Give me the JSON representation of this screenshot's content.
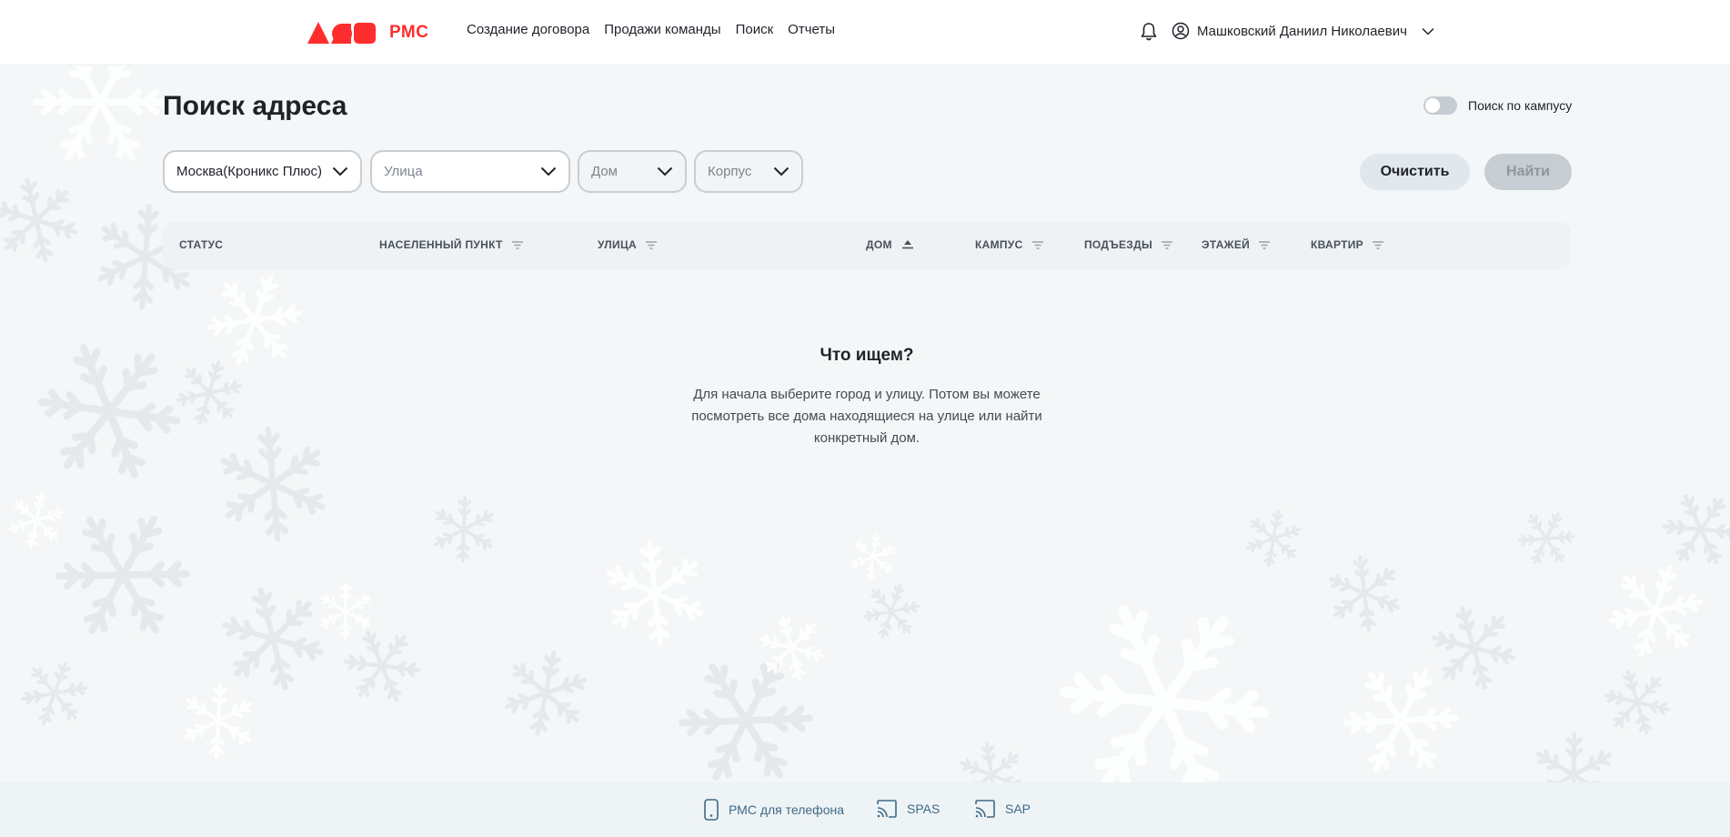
{
  "header": {
    "logo_text": "РМС",
    "nav": [
      "Создание договора",
      "Продажи команды",
      "Поиск",
      "Отчеты"
    ],
    "user_name": "Машковский Даниил Николаевич"
  },
  "page": {
    "title": "Поиск адреса",
    "campus_toggle_label": "Поиск по кампусу",
    "campus_toggle_on": false
  },
  "filters": {
    "city_value": "Москва(Кроникс Плюс)",
    "street_placeholder": "Улица",
    "house_placeholder": "Дом",
    "building_placeholder": "Корпус"
  },
  "buttons": {
    "clear": "Очистить",
    "find": "Найти"
  },
  "table": {
    "columns": [
      "СТАТУС",
      "НАСЕЛЕННЫЙ ПУНКТ",
      "УЛИЦА",
      "ДОМ",
      "КАМПУС",
      "ПОДЪЕЗДЫ",
      "ЭТАЖЕЙ",
      "КВАРТИР"
    ],
    "column_icons": [
      "",
      "filter-icon",
      "filter-icon",
      "sort-asc-icon",
      "filter-icon",
      "filter-icon",
      "filter-icon",
      "filter-icon"
    ]
  },
  "empty_state": {
    "title": "Что ищем?",
    "text": "Для начала выберите город и улицу. Потом вы можете посмотреть все дома находящиеся на улице или найти конкретный дом."
  },
  "footer": {
    "links": [
      "РМС для телефона",
      "SPAS",
      "SAP"
    ],
    "link_icons": [
      "phone-icon",
      "cast-icon",
      "cast-icon"
    ]
  },
  "colors": {
    "brand": "#ff2e2e",
    "footer_link": "#3e6a86",
    "table_header_bg": "#eef2f5"
  }
}
